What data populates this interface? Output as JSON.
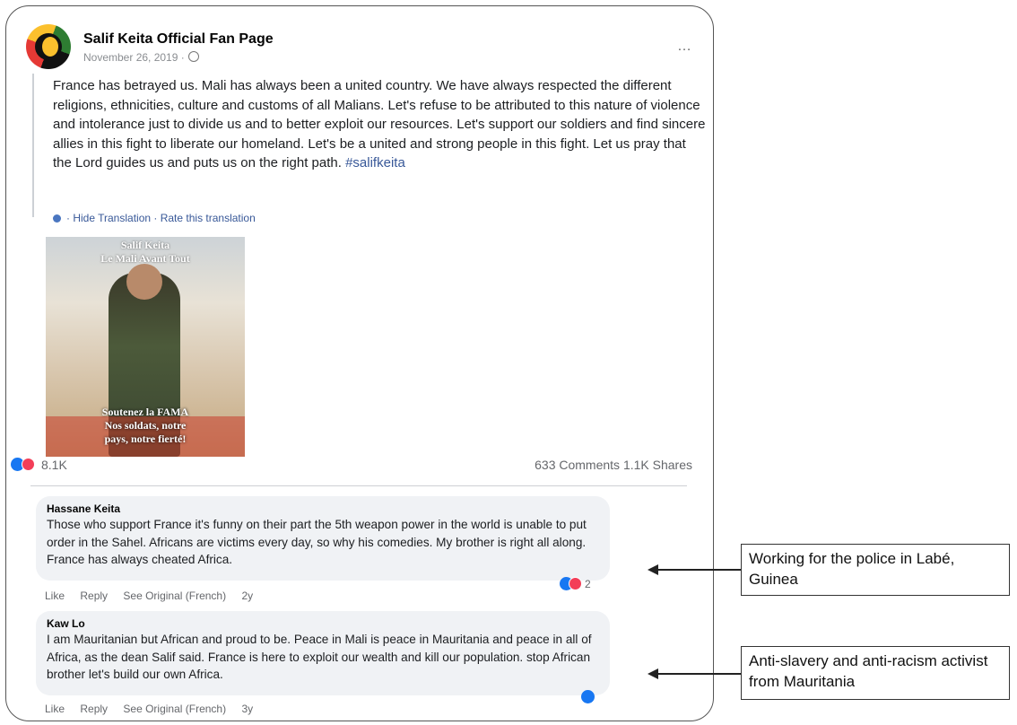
{
  "post": {
    "page_name": "Salif Keita Official Fan Page",
    "date": "November 26, 2019 ·",
    "more_label": "…",
    "text": "France has betrayed us. Mali has always been a united country. We have always respected the different religions, ethnicities, culture and customs of all Malians. Let's refuse to be attributed to this nature of violence and intolerance just to divide us and to better exploit our resources. Let's support our soldiers and find sincere allies in this fight to liberate our homeland. Let's be a united and strong people in this fight. Let us pray that the Lord guides us and puts us on the right path.",
    "hashtag": "#salifkeita",
    "translation_links": "· Hide Translation · Rate this translation",
    "image_text_top": "Salif Keita\nLe Mali Avant Tout",
    "image_text_bottom": "Soutenez la FAMA\nNos soldats, notre\npays, notre fierté!",
    "reaction_count": "8.1K",
    "stats": "633 Comments  1.1K Shares"
  },
  "comments": [
    {
      "author": "Hassane Keita",
      "text": "Those who support France it's funny on their part the 5th weapon power in the world is unable to put order in the Sahel. Africans are victims every day, so why his comedies. My brother is right all along. France has always cheated Africa.",
      "like": "Like",
      "reply": "Reply",
      "see_original": "See Original (French)",
      "age": "2y",
      "reaction_count": "2"
    },
    {
      "author": "Kaw Lo",
      "text": "I am Mauritanian but African and proud to be. Peace in Mali is peace in Mauritania and peace in all of Africa, as the dean Salif said. France is here to exploit our wealth and kill our population. stop African brother let's build our own Africa.",
      "like": "Like",
      "reply": "Reply",
      "see_original": "See Original (French)",
      "age": "3y",
      "reaction_count": ""
    }
  ],
  "annotations": [
    {
      "text": "Working for the police in Labé, Guinea"
    },
    {
      "text": "Anti-slavery and anti-racism activist from Mauritania"
    }
  ],
  "colors": {
    "link": "#385898",
    "like": "#1877f2",
    "love": "#f33e58",
    "comment_bg": "#f0f2f5"
  }
}
